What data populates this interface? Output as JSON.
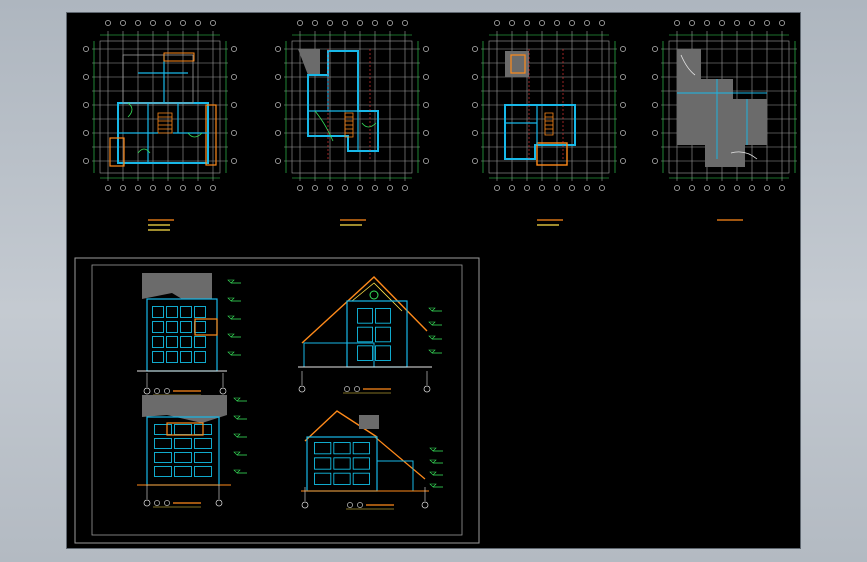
{
  "colors": {
    "paper": "#000000",
    "chrome": "#b9c0c8",
    "grid": "#9e9e9e",
    "wall": "#18b8e8",
    "cyan": "#15d4ff",
    "orange": "#ff8a1a",
    "yellow": "#ffe14a",
    "green": "#37e05a",
    "red": "#ff3b3b",
    "fill": "#6b6b6b",
    "white": "#e6e6e6",
    "border": "#9b9b9b"
  },
  "plans": [
    {
      "name": "plan-ground-floor",
      "caption_lines": 3
    },
    {
      "name": "plan-second-floor",
      "caption_lines": 2
    },
    {
      "name": "plan-third-floor",
      "caption_lines": 2
    },
    {
      "name": "plan-roof",
      "caption_lines": 1
    }
  ],
  "elevations": [
    {
      "name": "elevation-front"
    },
    {
      "name": "elevation-side-right"
    },
    {
      "name": "elevation-rear"
    },
    {
      "name": "elevation-side-left"
    }
  ]
}
